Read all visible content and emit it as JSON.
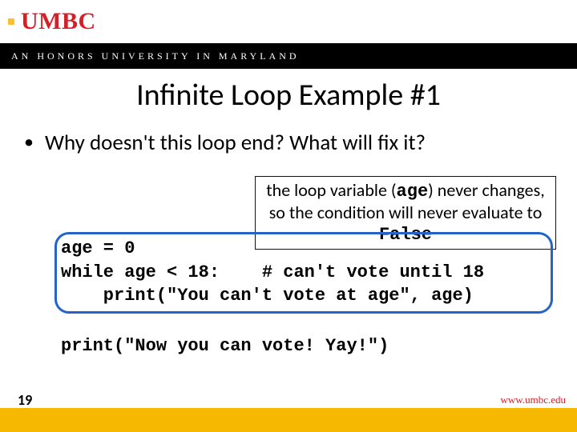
{
  "org": {
    "name": "UMBC",
    "subtitle": "AN HONORS UNIVERSITY IN MARYLAND",
    "site": "www.umbc.edu"
  },
  "slide": {
    "number": "19",
    "title": "Infinite Loop Example #1",
    "bullet": "Why doesn't this loop end?  What will fix it?"
  },
  "callout": {
    "prefix": "the loop variable (",
    "var": "age",
    "mid": ") never changes, so the condition will never evaluate to ",
    "value": "False"
  },
  "code": {
    "boxed": "age = 0\nwhile age < 18:    # can't vote until 18\n    print(\"You can't vote at age\", age)",
    "after": "print(\"Now you can vote! Yay!\")"
  },
  "colors": {
    "brand_red": "#d61f26",
    "brand_gold": "#f6b800",
    "highlight_blue": "#2563c9"
  }
}
